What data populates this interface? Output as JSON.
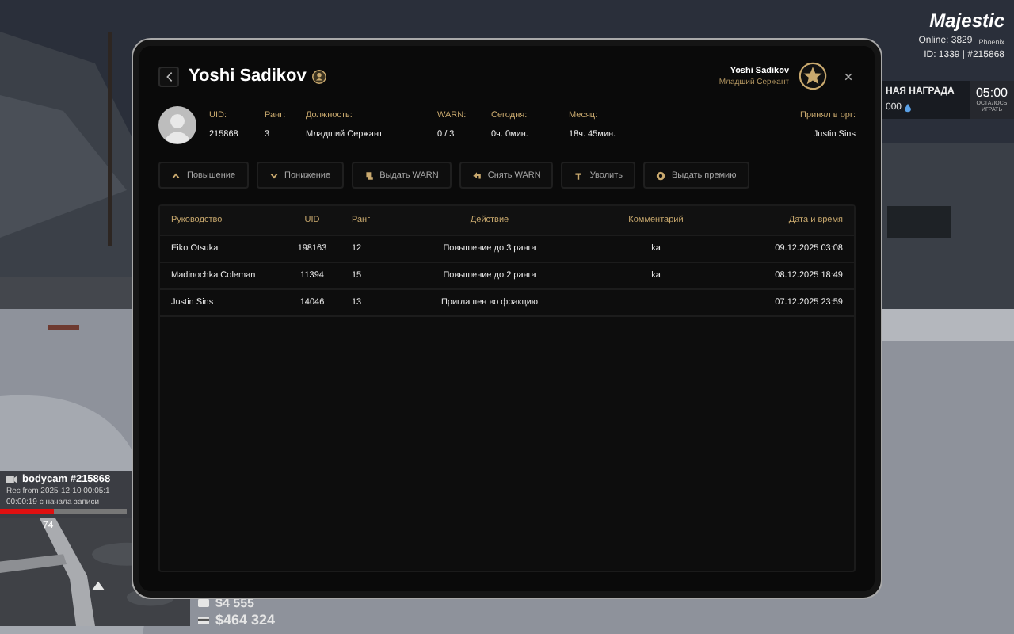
{
  "hud": {
    "logo": "Majestic",
    "online": "Online: 3829",
    "server": "Phoenix",
    "id": "ID: 1339 | #215868",
    "reward": {
      "title": "НАЯ НАГРАДА",
      "amount": "000"
    },
    "timer": {
      "time": "05:00",
      "caption": "ОСТАЛОСЬ ИГРАТЬ"
    },
    "bodycam": {
      "title": "bodycam #215868",
      "rec": "Rec from 2025-12-10 00:05:1",
      "elapsed": "00:00:19 с начала записи",
      "level": 0.42
    },
    "map_label": "74",
    "cash": "$4 555",
    "bank": "$464 324"
  },
  "profile": {
    "name": "Yoshi Sadikov",
    "user_name": "Yoshi Sadikov",
    "user_rank": "Младший Сержант",
    "fields": [
      {
        "label": "UID:",
        "value": "215868"
      },
      {
        "label": "Ранг:",
        "value": "3"
      },
      {
        "label": "Должность:",
        "value": "Младший Сержант"
      },
      {
        "label": "WARN:",
        "value": "0 / 3"
      },
      {
        "label": "Сегодня:",
        "value": "0ч. 0мин."
      },
      {
        "label": "Месяц:",
        "value": "18ч. 45мин."
      }
    ],
    "accepted": {
      "label": "Принял в орг:",
      "value": "Justin Sins"
    }
  },
  "actions": [
    {
      "kind": "promote",
      "label": "Повышение"
    },
    {
      "kind": "demote",
      "label": "Понижение"
    },
    {
      "kind": "warn",
      "label": "Выдать WARN"
    },
    {
      "kind": "unwarn",
      "label": "Снять WARN"
    },
    {
      "kind": "fire",
      "label": "Уволить"
    },
    {
      "kind": "bonus",
      "label": "Выдать премию"
    }
  ],
  "table": {
    "columns": [
      "Руководство",
      "UID",
      "Ранг",
      "Действие",
      "Комментарий",
      "Дата и время"
    ],
    "rows": [
      [
        "Eiko Otsuka",
        "198163",
        "12",
        "Повышение до 3 ранга",
        "ka",
        "09.12.2025 03:08"
      ],
      [
        "Madinochka Coleman",
        "11394",
        "15",
        "Повышение до 2 ранга",
        "ka",
        "08.12.2025 18:49"
      ],
      [
        "Justin Sins",
        "14046",
        "13",
        "Приглашен во фракцию",
        "",
        "07.12.2025 23:59"
      ]
    ]
  }
}
